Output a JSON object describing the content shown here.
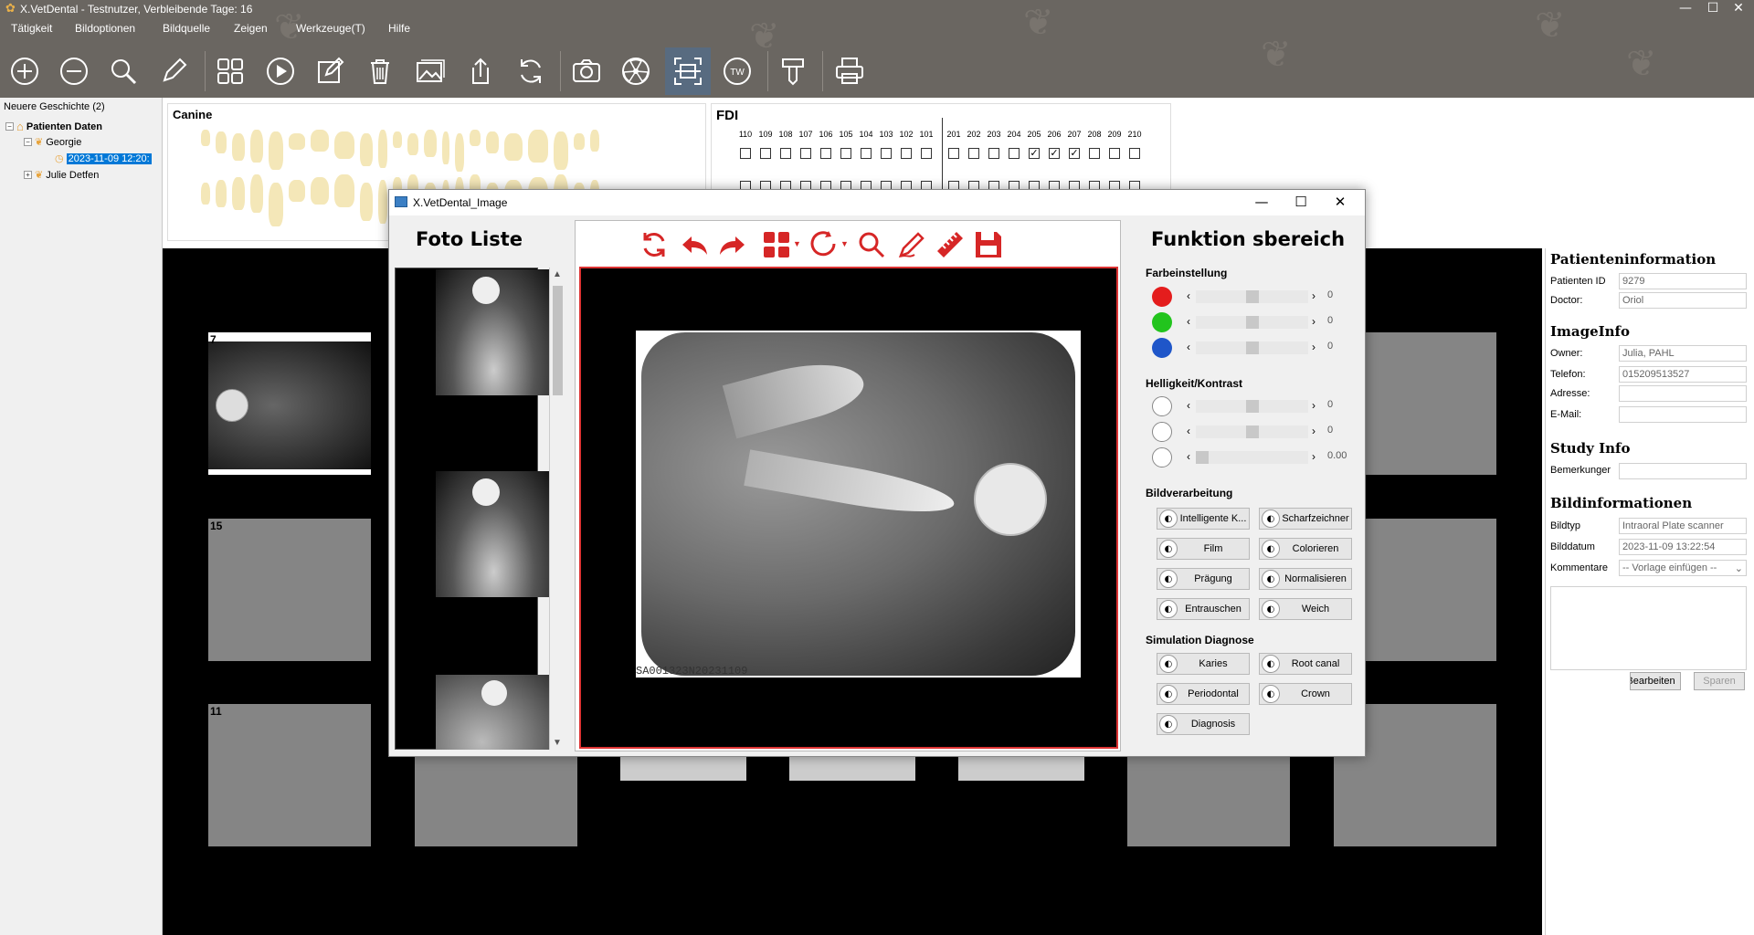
{
  "window": {
    "title": "X.VetDental - Testnutzer, Verbleibende Tage: 16"
  },
  "menu": [
    "Tätigkeit",
    "Bildoptionen",
    "Bildquelle",
    "Zeigen",
    "Werkzeuge(T)",
    "Hilfe"
  ],
  "toolbar": {
    "icons": [
      "add-icon",
      "remove-icon",
      "search-icon",
      "pencil-icon",
      "grid-icon",
      "play-icon",
      "edit-icon",
      "trash-icon",
      "image-icon",
      "export-icon",
      "refresh-icon",
      "camera-icon",
      "radiation-icon",
      "scan-icon",
      "tw-icon",
      "sensor-icon",
      "print-icon"
    ],
    "tw_label": "TW"
  },
  "tree": {
    "header": "Neuere Geschichte (2)",
    "root": "Patienten Daten",
    "patients": [
      {
        "name": "Georgie",
        "date": "2023-11-09 12:20:"
      },
      {
        "name": "Julie Detfen"
      }
    ]
  },
  "canine_panel": {
    "label": "Canine"
  },
  "fdi_panel": {
    "label": "FDI",
    "numbers": [
      "110",
      "109",
      "108",
      "107",
      "106",
      "105",
      "104",
      "103",
      "102",
      "101",
      "201",
      "202",
      "203",
      "204",
      "205",
      "206",
      "207",
      "208",
      "209",
      "210"
    ],
    "checked": [
      false,
      false,
      false,
      false,
      false,
      false,
      false,
      false,
      false,
      false,
      false,
      false,
      false,
      false,
      true,
      true,
      true,
      false,
      false,
      false
    ]
  },
  "gallery": {
    "slots": [
      {
        "num": "7"
      },
      {
        "num": "15"
      },
      {
        "num": "11"
      }
    ]
  },
  "image_dialog": {
    "title": "X.VetDental_Image",
    "foto_liste": "Foto Liste",
    "funktion": "Funktion sbereich",
    "image_code": "SA001323N20231109",
    "farbe": {
      "label": "Farbeinstellung",
      "rows": [
        {
          "color": "#e41d1d",
          "value": "0",
          "level": 0.5
        },
        {
          "color": "#22c41d",
          "value": "0",
          "level": 0.5
        },
        {
          "color": "#1f56c9",
          "value": "0",
          "level": 0.5
        }
      ]
    },
    "helligkeit": {
      "label": "Helligkeit/Kontrast",
      "rows": [
        {
          "value": "0",
          "level": 0.5
        },
        {
          "value": "0",
          "level": 0.5
        },
        {
          "value": "0.00",
          "level": 0.0
        }
      ]
    },
    "bildverarbeitung": {
      "label": "Bildverarbeitung",
      "buttons": [
        "Intelligente K...",
        "Scharfzeichner",
        "Film",
        "Colorieren",
        "Prägung",
        "Normalisieren",
        "Entrauschen",
        "Weich"
      ]
    },
    "simulation": {
      "label": "Simulation Diagnose",
      "buttons": [
        "Karies",
        "Root canal",
        "Periodontal",
        "Crown",
        "Diagnosis"
      ]
    }
  },
  "info_panel": {
    "patienteninfo": "Patienteninformation",
    "patient_id_label": "Patienten ID",
    "patient_id": "9279",
    "doctor_label": "Doctor:",
    "doctor": "Oriol",
    "imageinfo": "ImageInfo",
    "owner_label": "Owner:",
    "owner": "Julia, PAHL",
    "telefon_label": "Telefon:",
    "telefon": "015209513527",
    "adresse_label": "Adresse:",
    "adresse": "",
    "email_label": "E-Mail:",
    "email": "",
    "studyinfo": "Study Info",
    "bemerkungen_label": "Bemerkunger",
    "bemerkungen": "",
    "bildinfo": "Bildinformationen",
    "bildtyp_label": "Bildtyp",
    "bildtyp": "Intraoral Plate scanner",
    "bilddatum_label": "Bilddatum",
    "bilddatum": "2023-11-09 13:22:54",
    "kommentare_label": "Kommentare",
    "kommentare_placeholder": "-- Vorlage einfügen --",
    "bearbeiten": "Bearbeiten",
    "sparen": "Sparen"
  }
}
